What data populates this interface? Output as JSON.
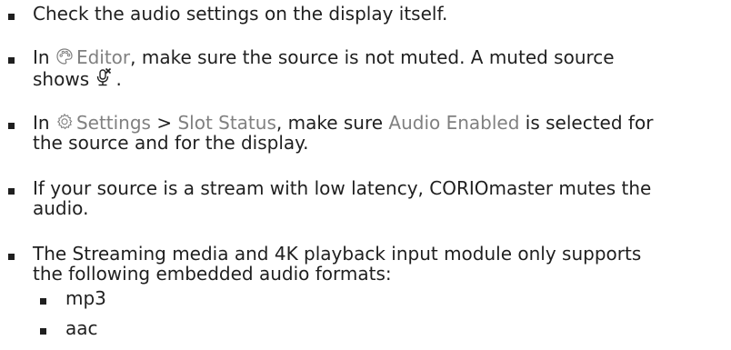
{
  "items": {
    "check_display": {
      "text": "Check the audio settings on the display itself."
    },
    "editor": {
      "prefix": "In ",
      "icon": "palette-icon",
      "link": "Editor",
      "suffix": ", make sure the source is not muted. A muted source",
      "line2": "shows ",
      "muted_icon": "muted-mic-icon",
      "line2_end": "."
    },
    "settings": {
      "prefix": "In ",
      "icon": "gear-icon",
      "link1": "Settings",
      "sep": " > ",
      "link2": "Slot Status",
      "mid": ", make sure ",
      "link3": "Audio Enabled",
      "suffix": " is selected for",
      "line2": "the source and for the display."
    },
    "stream": {
      "line1": "If your source is a stream with low latency, CORIOmaster mutes the",
      "line2": "audio."
    },
    "module": {
      "line1": "The Streaming media and 4K playback input module only supports",
      "line2": "the following embedded audio formats:"
    },
    "formats": [
      "mp3",
      "aac"
    ]
  },
  "colors": {
    "text": "#1f1f1f",
    "link": "#808080"
  }
}
